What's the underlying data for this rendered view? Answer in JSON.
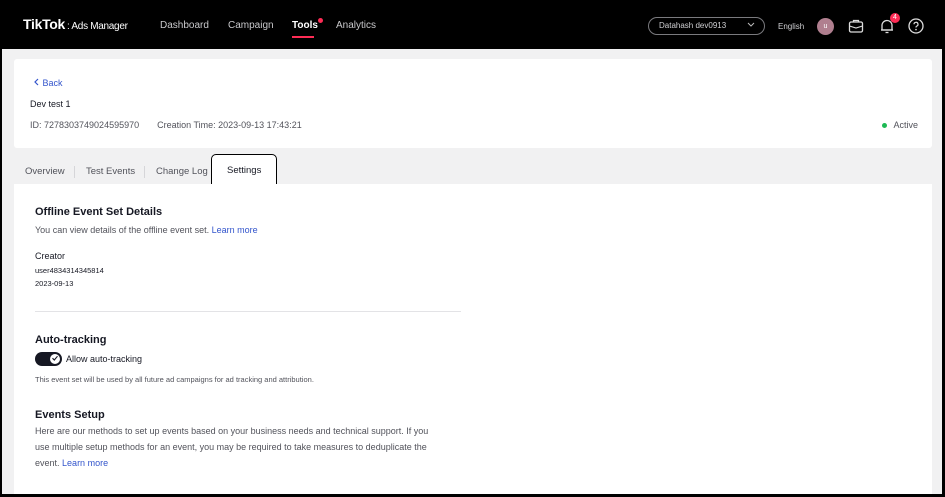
{
  "nav": {
    "logo": "TikTok",
    "logo_sub": ": Ads Manager",
    "items": [
      {
        "label": "Dashboard"
      },
      {
        "label": "Campaign"
      },
      {
        "label": "Tools"
      },
      {
        "label": "Analytics"
      }
    ],
    "account": "Datahash dev0913",
    "language": "English",
    "avatar_initial": "u",
    "notification_count": "4",
    "accent": "#fe2c55"
  },
  "header": {
    "back_label": "Back",
    "name": "Dev test 1",
    "id_text": "ID: 7278303749024595970",
    "creation_text": "Creation Time: 2023-09-13 17:43:21",
    "status": "Active",
    "status_color": "#1db954"
  },
  "tabs": [
    {
      "label": "Overview"
    },
    {
      "label": "Test Events"
    },
    {
      "label": "Change Log"
    },
    {
      "label": "Settings"
    }
  ],
  "details": {
    "title": "Offline Event Set Details",
    "desc": "You can view details of the offline event set.",
    "learn_more": "Learn more",
    "creator_label": "Creator",
    "creator_user": "user4834314345814",
    "creator_date": "2023-09-13"
  },
  "autotracking": {
    "title": "Auto-tracking",
    "toggle_label": "Allow auto-tracking",
    "toggle_on": true,
    "hint": "This event set will be used by all future ad campaigns for ad tracking and attribution."
  },
  "events_setup": {
    "title": "Events Setup",
    "desc_line1": "Here are our methods to set up events based on your business needs and technical support. If you",
    "desc_line2": "use multiple setup methods for an event, you may be required to take measures to deduplicate the",
    "desc_line3": "event.",
    "learn_more": "Learn more"
  }
}
